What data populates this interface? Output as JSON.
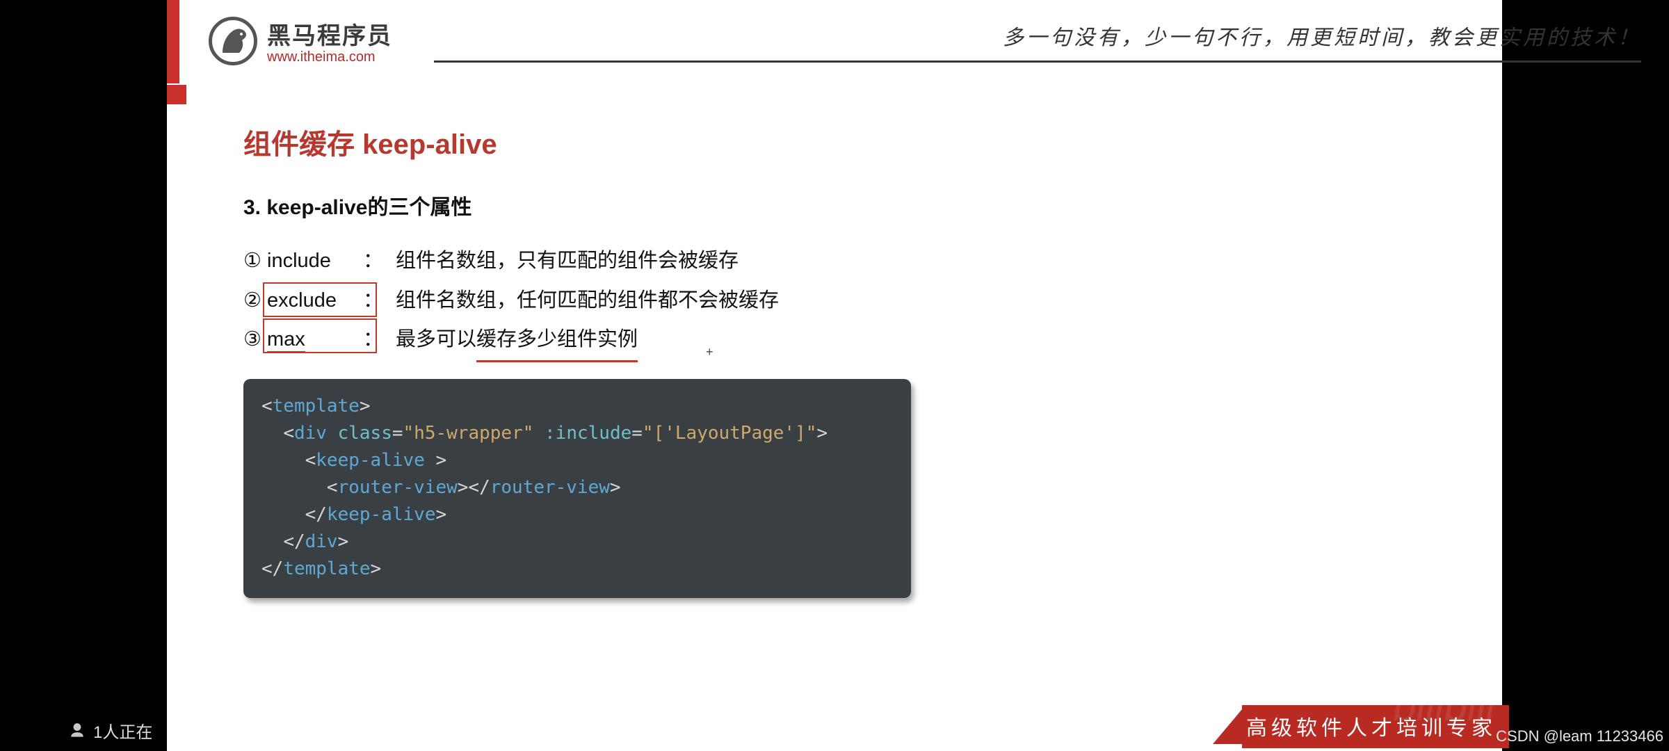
{
  "brand": {
    "org_name": "黑马程序员",
    "org_url": "www.itheima.com",
    "tagline": "多一句没有，少一句不行，用更短时间，教会更实用的技术！"
  },
  "slide": {
    "title": "组件缓存 keep-alive",
    "subtitle": "3. keep-alive的三个属性",
    "props": [
      {
        "num": "①",
        "name": "include",
        "desc": "组件名数组，只有匹配的组件会被缓存",
        "highlight": "none"
      },
      {
        "num": "②",
        "name": "exclude",
        "desc": "组件名数组，任何匹配的组件都不会被缓存",
        "highlight": "box"
      },
      {
        "num": "③",
        "name": "max",
        "desc_pre": "最多可以",
        "desc_underlined": "缓存多少组件实例",
        "highlight": "box-underline"
      }
    ],
    "code": {
      "l1_tag": "template",
      "l2_tag": "div",
      "l2_attr_class": "class",
      "l2_val_class": "\"h5-wrapper\"",
      "l2_attr_inc": ":include",
      "l2_val_inc": "\"['LayoutPage']\"",
      "l3_tag": "keep-alive",
      "l4_tag": "router-view"
    }
  },
  "footer": {
    "label": "高级软件人才培训专家"
  },
  "overlay": {
    "viewers": "1人正在",
    "csdn": "CSDN @leam 11233466"
  }
}
